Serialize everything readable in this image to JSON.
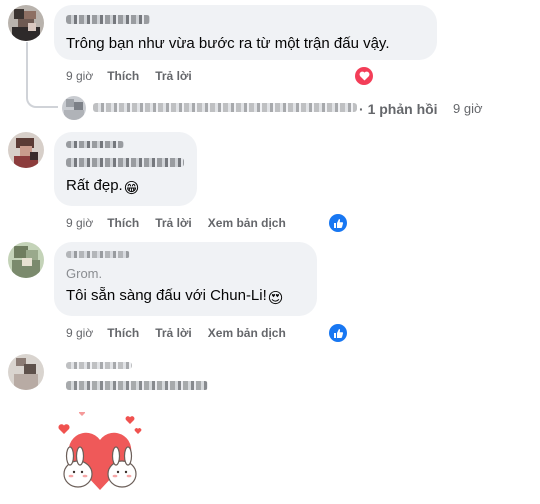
{
  "comments": [
    {
      "text": "Trông bạn như vừa bước ra từ một trận đấu vậy.",
      "actions": {
        "time": "9 giờ",
        "like": "Thích",
        "reply": "Trả lời"
      },
      "reaction": "heart-icon"
    },
    {
      "text": "Rất đẹp.",
      "emoji": "😁",
      "actions": {
        "time": "9 giờ",
        "like": "Thích",
        "reply": "Trả lời",
        "translate": "Xem bản dịch"
      },
      "reaction": "like-icon"
    },
    {
      "text_first_line": "Grom.",
      "text": "Tôi sẵn sàng đấu với Chun-Li!",
      "emoji": "😍",
      "actions": {
        "time": "9 giờ",
        "like": "Thích",
        "reply": "Trả lời",
        "translate": "Xem bản dịch"
      },
      "reaction": "like-icon"
    }
  ],
  "reply_thread": {
    "separator": "·",
    "count_label": "1 phản hồi",
    "time": "9 giờ"
  },
  "sticker": {
    "icon": "bunnies-heart-sticker"
  },
  "colors": {
    "bubble": "#f0f2f5",
    "secondary_text": "#65676b",
    "like_blue": "#1877f2",
    "love_red": "#f33e58"
  }
}
